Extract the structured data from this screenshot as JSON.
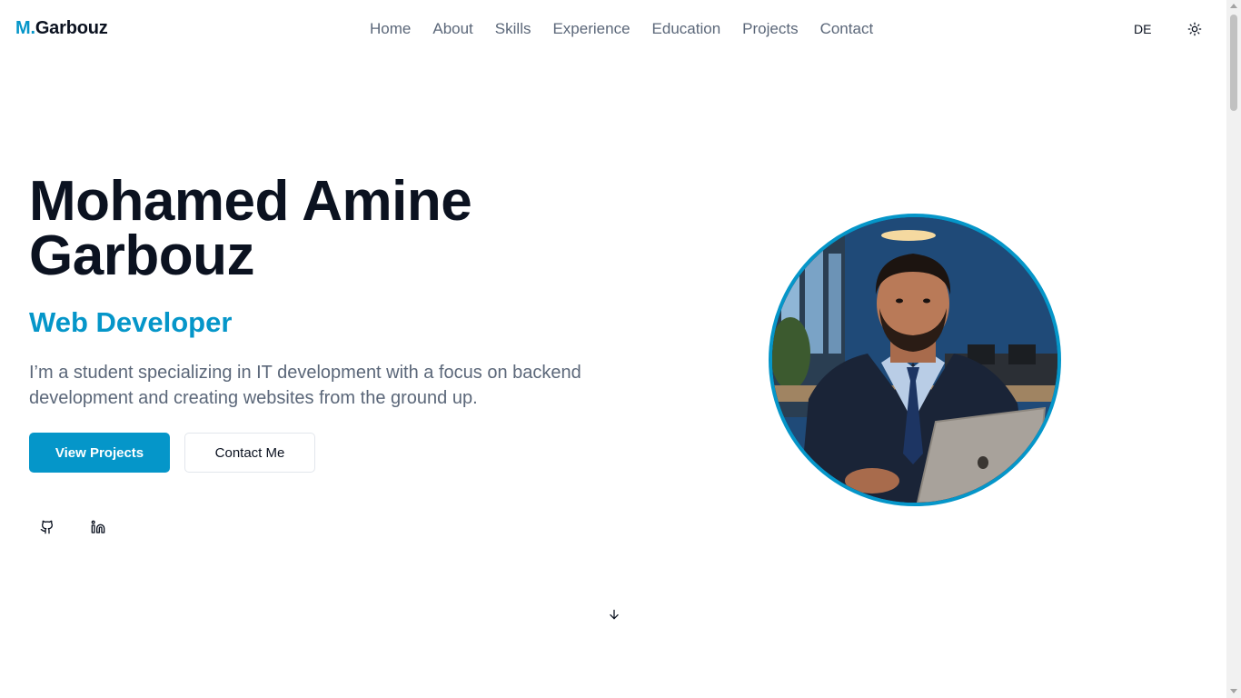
{
  "header": {
    "logo_accent": "M.",
    "logo_rest": "Garbouz",
    "nav": [
      "Home",
      "About",
      "Skills",
      "Experience",
      "Education",
      "Projects",
      "Contact"
    ],
    "language": "DE",
    "theme_icon": "sun-icon"
  },
  "hero": {
    "name": "Mohamed Amine Garbouz",
    "role": "Web Developer",
    "description": "I’m a student specializing in IT development with a focus on backend development and creating websites from the ground up.",
    "primary_button": "View Projects",
    "secondary_button": "Contact Me",
    "social_icons": [
      "github-icon",
      "linkedin-icon"
    ],
    "scroll_icon": "arrow-down-icon",
    "portrait_icon": "profile-photo"
  },
  "colors": {
    "accent": "#0596c9",
    "text_dark": "#0b1220",
    "text_muted": "#5b6779",
    "background": "#ffffff"
  }
}
